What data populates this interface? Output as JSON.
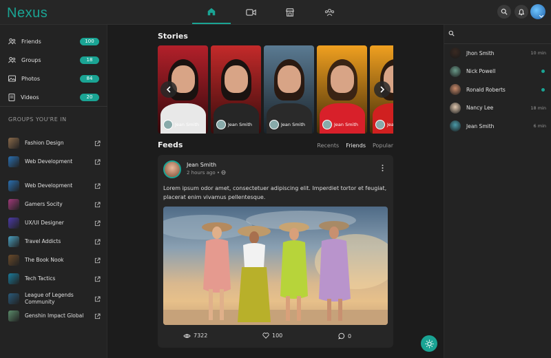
{
  "app": {
    "logo": "Nexus"
  },
  "topnav": {
    "icons": [
      "home-icon",
      "video-icon",
      "store-icon",
      "groups-icon"
    ],
    "right_icons": [
      "search-icon",
      "bell-icon",
      "avatar"
    ]
  },
  "sidebar": {
    "items": [
      {
        "label": "Friends",
        "count": "100",
        "icon": "friends-icon"
      },
      {
        "label": "Groups",
        "count": "18",
        "icon": "groups-icon"
      },
      {
        "label": "Photos",
        "count": "84",
        "icon": "photos-icon"
      },
      {
        "label": "Videos",
        "count": "20",
        "icon": "videos-icon"
      }
    ],
    "groups_title": "GROUPS YOU'RE IN",
    "groups": [
      {
        "name": "Fashion Design",
        "color": "#8a6a4a"
      },
      {
        "name": "Web Development",
        "color": "#2a6fb0"
      },
      {
        "name": "Web Development",
        "color": "#2a6fb0"
      },
      {
        "name": "Gamers Socity",
        "color": "#a03a7a"
      },
      {
        "name": "UX/UI Designer",
        "color": "#4b3aa8"
      },
      {
        "name": "Travel Addicts",
        "color": "#4aa0c0"
      },
      {
        "name": "The Book Nook",
        "color": "#6a4a2a"
      },
      {
        "name": "Tech Tactics",
        "color": "#1a7a9a"
      },
      {
        "name": "League of Legends Community",
        "color": "#2a5a7a"
      },
      {
        "name": "Genshin Impact Global",
        "color": "#5a8a6a"
      }
    ]
  },
  "stories": {
    "title": "Stories",
    "items": [
      {
        "name": "Jean Smith",
        "bg": "#b3202a",
        "body": "#e8e8e8",
        "hair": "#1a1210"
      },
      {
        "name": "Jean Smith",
        "bg": "#c42a2a",
        "body": "#262626",
        "hair": "#1a1210"
      },
      {
        "name": "Jean Smith",
        "bg": "#5a7a92",
        "body": "#2a2a2a",
        "hair": "#2a1a12"
      },
      {
        "name": "Jean Smith",
        "bg": "#f0a020",
        "body": "#d8202a",
        "hair": "#3a2414"
      },
      {
        "name": "Jean Smith",
        "bg": "#f0a020",
        "body": "#d02020",
        "hair": "#2a1a10"
      }
    ]
  },
  "feeds": {
    "title": "Feeds",
    "tabs": [
      {
        "label": "Recents",
        "active": false
      },
      {
        "label": "Friends",
        "active": true
      },
      {
        "label": "Popular",
        "active": false
      }
    ]
  },
  "post": {
    "author": "Jean Smith",
    "time": "2 hours ago",
    "visibility_icon": "globe-icon",
    "text": "Lorem ipsum odor amet, consectetuer adipiscing elit. Imperdiet tortor et feugiat, placerat enim vivamus pellentesque.",
    "views": "7322",
    "likes": "100",
    "comments": "0"
  },
  "contacts": [
    {
      "name": "Jhon Smith",
      "meta": "10 min",
      "online": false,
      "color": "#3a2a22"
    },
    {
      "name": "Nick Powell",
      "meta": "",
      "online": true,
      "color": "#6a9a8a"
    },
    {
      "name": "Ronald Roberts",
      "meta": "",
      "online": true,
      "color": "#c88a6a"
    },
    {
      "name": "Nancy Lee",
      "meta": "18 min",
      "online": false,
      "color": "#e0c8b0"
    },
    {
      "name": "Jean Smith",
      "meta": "6 min",
      "online": false,
      "color": "#4a9aa8"
    }
  ],
  "accent": "#1aa494"
}
